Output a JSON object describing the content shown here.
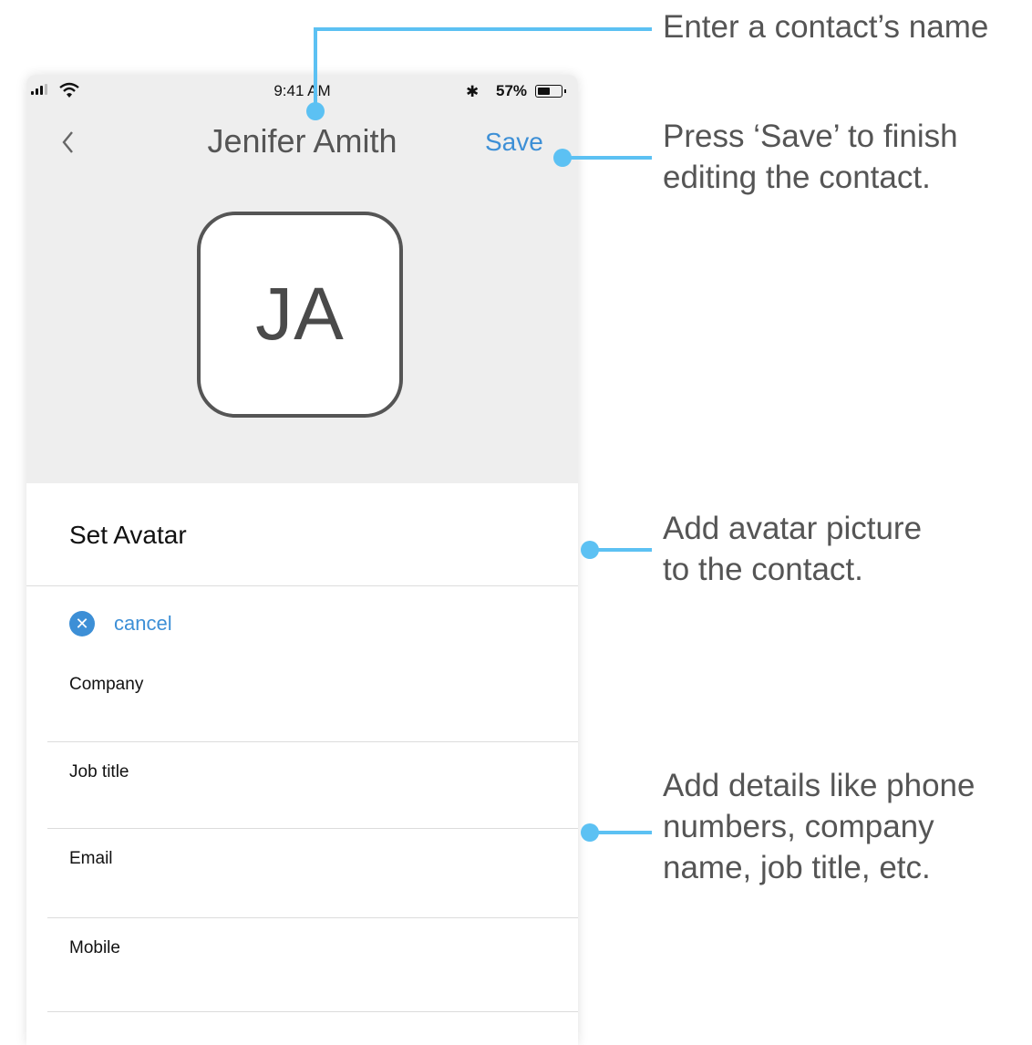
{
  "status_bar": {
    "time": "9:41 AM",
    "battery_percent": "57%",
    "battery_level": 0.57
  },
  "nav": {
    "back_icon": "chevron-left-icon",
    "title": "Jenifer Amith",
    "save_label": "Save"
  },
  "avatar": {
    "initials": "JA"
  },
  "set_avatar": {
    "label": "Set Avatar"
  },
  "cancel": {
    "icon": "close-circle-icon",
    "label": "cancel"
  },
  "fields": [
    {
      "label": "Company"
    },
    {
      "label": "Job title"
    },
    {
      "label": "Email"
    },
    {
      "label": "Mobile"
    }
  ],
  "callouts": {
    "name": {
      "line1": "Enter a contact’s name"
    },
    "save": {
      "line1": "Press ‘Save’ to finish",
      "line2": "editing the contact."
    },
    "avatar": {
      "line1": "Add avatar picture",
      "line2": "to the contact."
    },
    "details": {
      "line1": "Add details like phone",
      "line2": "numbers, company",
      "line3": "name, job title, etc."
    }
  },
  "colors": {
    "accent": "#3d8fd6",
    "callout_line": "#5cc1f3",
    "header_bg": "#eeeeee"
  }
}
